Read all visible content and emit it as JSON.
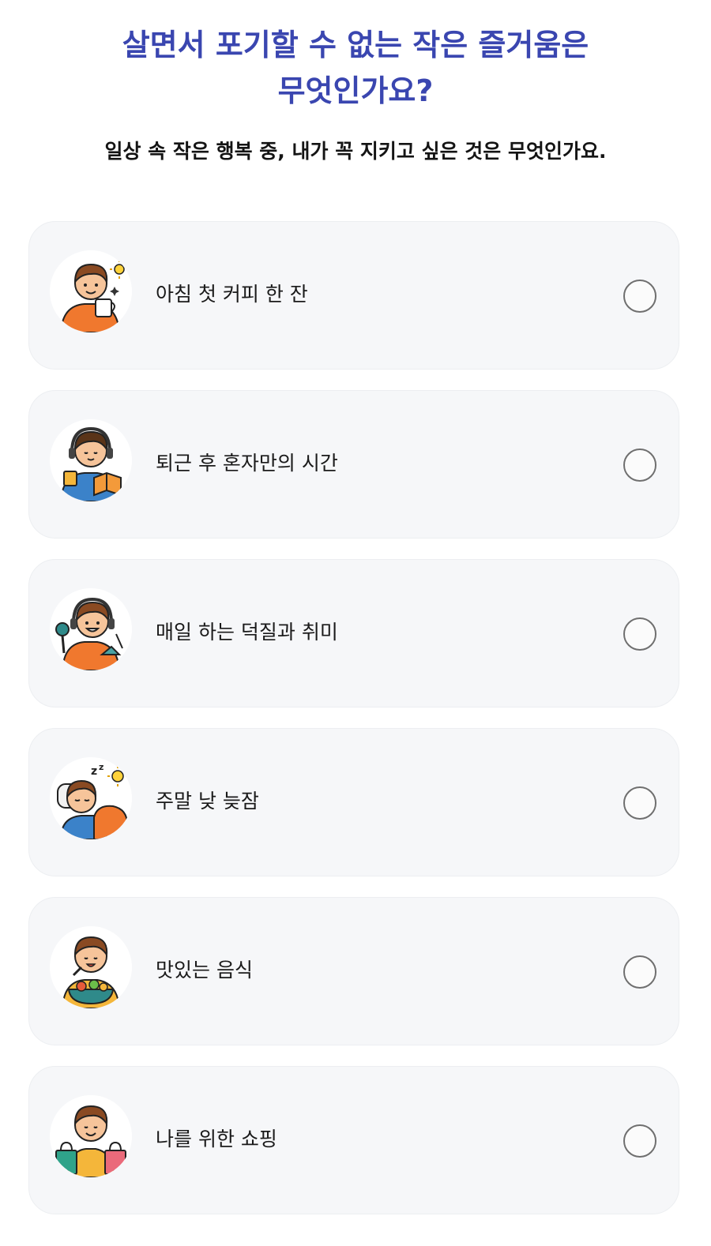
{
  "header": {
    "title_line1": "살면서 포기할 수 없는 작은 즐거움은",
    "title_line2": "무엇인가요?",
    "subtitle": "일상 속 작은 행복 중, 내가 꼭 지키고 싶은 것은 무엇인가요."
  },
  "options": [
    {
      "label": "아침 첫 커피 한 잔",
      "icon": "coffee-person-icon"
    },
    {
      "label": "퇴근 후 혼자만의 시간",
      "icon": "reading-person-icon"
    },
    {
      "label": "매일 하는 덕질과 취미",
      "icon": "hobby-person-icon"
    },
    {
      "label": "주말 낮 늦잠",
      "icon": "sleeping-person-icon"
    },
    {
      "label": "맛있는 음식",
      "icon": "eating-person-icon"
    },
    {
      "label": "나를 위한 쇼핑",
      "icon": "shopping-person-icon"
    }
  ],
  "colors": {
    "title": "#3a46b0",
    "card_bg": "#f6f7f9",
    "radio_border": "#6f6f6f"
  }
}
